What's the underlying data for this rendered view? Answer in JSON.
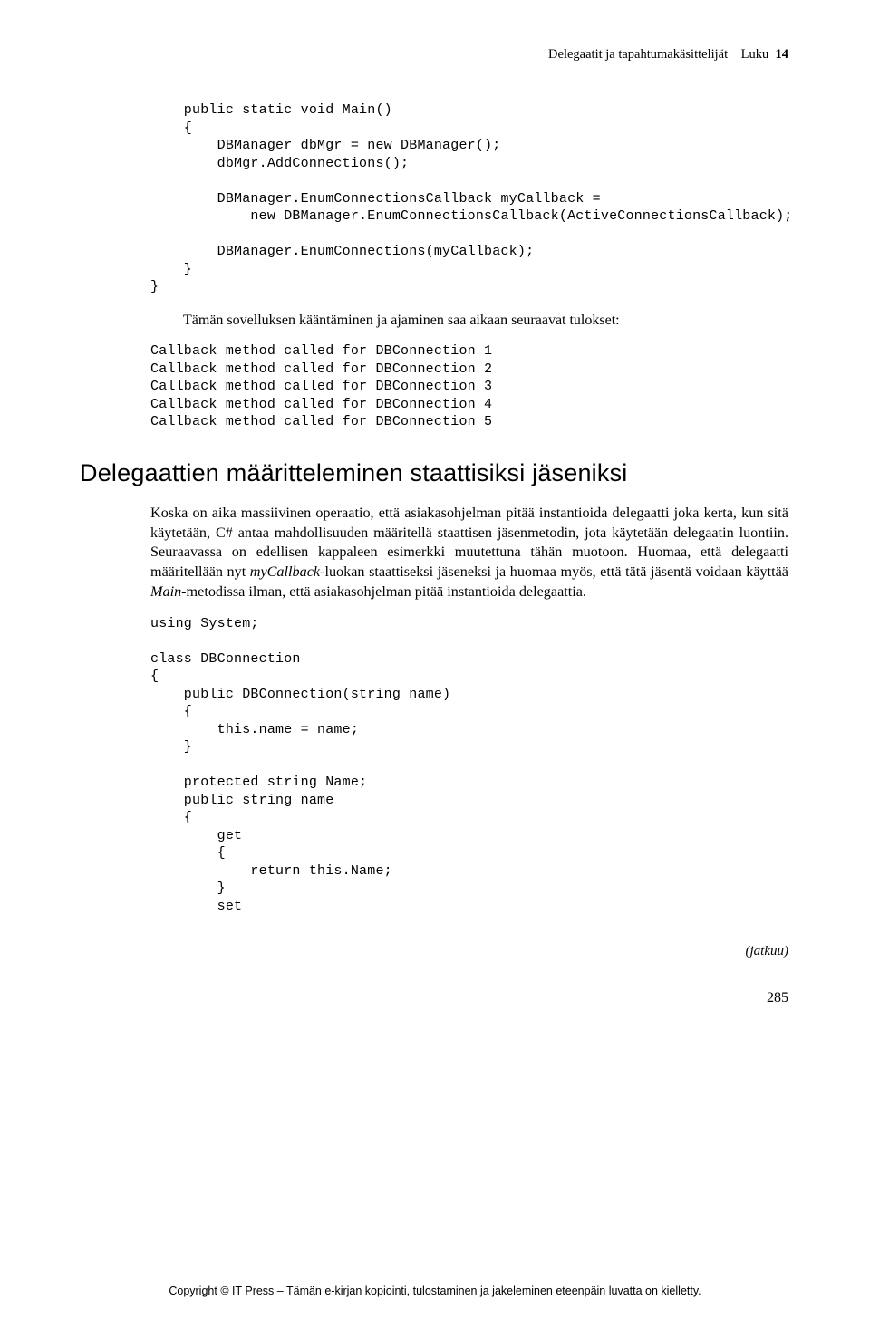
{
  "header": {
    "title": "Delegaatit ja tapahtumakäsittelijät",
    "chapter_label": "Luku",
    "chapter_num": "14"
  },
  "code1": "    public static void Main()\n    {\n        DBManager dbMgr = new DBManager();\n        dbMgr.AddConnections();\n\n        DBManager.EnumConnectionsCallback myCallback =\n            new DBManager.EnumConnectionsCallback(ActiveConnectionsCallback);\n\n        DBManager.EnumConnections(myCallback);\n    }\n}",
  "intro": "Tämän sovelluksen kääntäminen ja ajaminen saa aikaan seuraavat tulokset:",
  "code2": "Callback method called for DBConnection 1\nCallback method called for DBConnection 2\nCallback method called for DBConnection 3\nCallback method called for DBConnection 4\nCallback method called for DBConnection 5",
  "section_title": "Delegaattien määritteleminen staattisiksi jäseniksi",
  "body1_a": "Koska on aika massiivinen operaatio, että asiakasohjelman pitää instantioida delegaatti joka kerta, kun sitä käytetään, C# antaa mahdollisuuden määritellä staattisen jäsenmetodin, jota käytetään delegaatin luontiin. Seuraavassa on edellisen kappaleen esimerkki muutettuna tähän muotoon. Huomaa, että delegaatti määritellään nyt ",
  "body1_mycallback": "myCallback",
  "body1_b": "-luokan staattiseksi jäseneksi ja huomaa myös, että tätä jäsentä voidaan käyttää ",
  "body1_main": "Main",
  "body1_c": "-metodissa ilman, että asiakasohjelman pitää instantioida delegaattia.",
  "code3": "using System;\n\nclass DBConnection\n{\n    public DBConnection(string name)\n    {\n        this.name = name;\n    }\n\n    protected string Name;\n    public string name\n    {\n        get\n        {\n            return this.Name;\n        }\n        set",
  "jatkuu": "(jatkuu)",
  "page_number": "285",
  "footer": "Copyright © IT Press – Tämän e-kirjan kopiointi, tulostaminen ja jakeleminen eteenpäin luvatta on kielletty."
}
